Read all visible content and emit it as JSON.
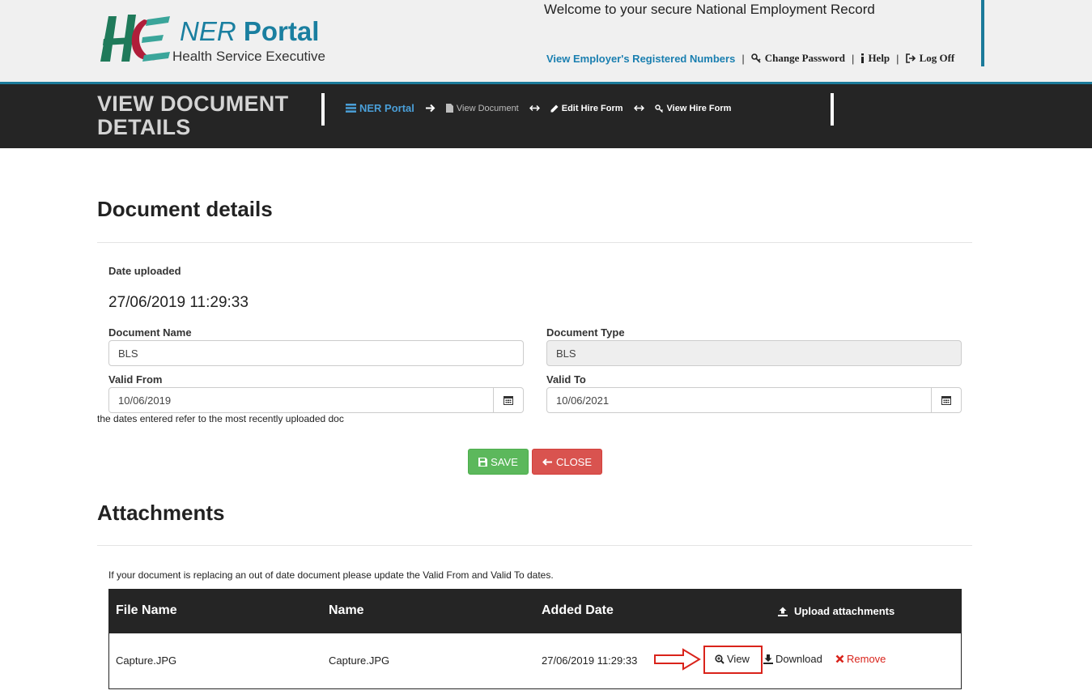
{
  "header": {
    "title_part1": "NER",
    "title_part2": "Portal",
    "subtitle": "Health Service Executive",
    "welcome": "Welcome to your secure National Employment Record",
    "links": {
      "registered_numbers": "View Employer's Registered Numbers",
      "change_password": "Change Password",
      "help": "Help",
      "log_off": "Log Off"
    },
    "accent": "#1b7a9a"
  },
  "titlebar": {
    "heading_line1": "VIEW DOCUMENT",
    "heading_line2": "DETAILS",
    "breadcrumbs": {
      "home": "NER Portal",
      "view_document": "View Document",
      "edit_hire_form": "Edit Hire Form",
      "view_hire_form": "View Hire Form"
    }
  },
  "document": {
    "section_title": "Document details",
    "date_uploaded_label": "Date uploaded",
    "date_uploaded_value": "27/06/2019 11:29:33",
    "name_label": "Document Name",
    "name_value": "BLS",
    "type_label": "Document Type",
    "type_value": "BLS",
    "valid_from_label": "Valid From",
    "valid_from_value": "10/06/2019",
    "valid_to_label": "Valid To",
    "valid_to_value": "10/06/2021",
    "note": "the dates entered refer to the most recently uploaded doc",
    "save_label": "SAVE",
    "close_label": "CLOSE"
  },
  "attachments": {
    "section_title": "Attachments",
    "info": "If your document is replacing an out of date document please update the Valid From and Valid To dates.",
    "columns": {
      "file_name": "File Name",
      "name": "Name",
      "added_date": "Added Date",
      "upload": "Upload attachments"
    },
    "rows": [
      {
        "file_name": "Capture.JPG",
        "name": "Capture.JPG",
        "added_date": "27/06/2019 11:29:33",
        "view": "View",
        "download": "Download",
        "remove": "Remove"
      }
    ]
  },
  "colors": {
    "brand_blue": "#1a7fa0",
    "dark_bar": "#252525",
    "save_green": "#5cb85c",
    "close_red": "#d9534f",
    "remove_red": "#d9241c",
    "highlight_red": "#d9231b"
  },
  "icons": [
    "hse-logo",
    "key-icon",
    "info-icon",
    "logout-icon",
    "list-icon",
    "arrow-right-icon",
    "file-icon",
    "double-arrow-icon",
    "pencil-icon",
    "calendar-icon",
    "floppy-icon",
    "arrow-left-icon",
    "upload-icon",
    "zoom-icon",
    "download-icon",
    "remove-icon",
    "annotation-arrow"
  ]
}
